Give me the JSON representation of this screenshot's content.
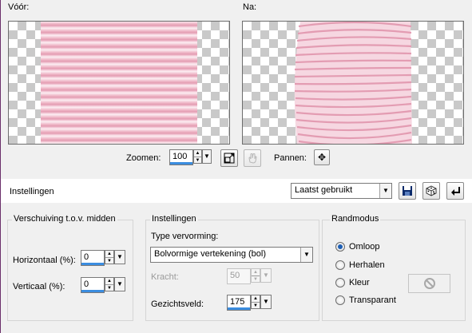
{
  "preview": {
    "before_label": "Vóór:",
    "after_label": "Na:",
    "zoom_label": "Zoomen:",
    "zoom_value": "100",
    "pan_label": "Pannen:"
  },
  "settings_bar": {
    "label": "Instellingen",
    "preset_value": "Laatst gebruikt"
  },
  "offset_group": {
    "title": "Verschuiving t.o.v. midden",
    "horizontal_label": "Horizontaal (%):",
    "horizontal_value": "0",
    "vertical_label": "Verticaal (%):",
    "vertical_value": "0"
  },
  "settings_group": {
    "title": "Instellingen",
    "type_label": "Type vervorming:",
    "type_value": "Bolvormige vertekening (bol)",
    "strength_label": "Kracht:",
    "strength_value": "50",
    "fov_label": "Gezichtsveld:",
    "fov_value": "175"
  },
  "edge_group": {
    "title": "Randmodus",
    "options": [
      "Omloop",
      "Herhalen",
      "Kleur",
      "Transparant"
    ],
    "selected": "Omloop"
  },
  "colors": {
    "accent": "#3b8de0",
    "stripe_pink": "#e39cb2"
  }
}
